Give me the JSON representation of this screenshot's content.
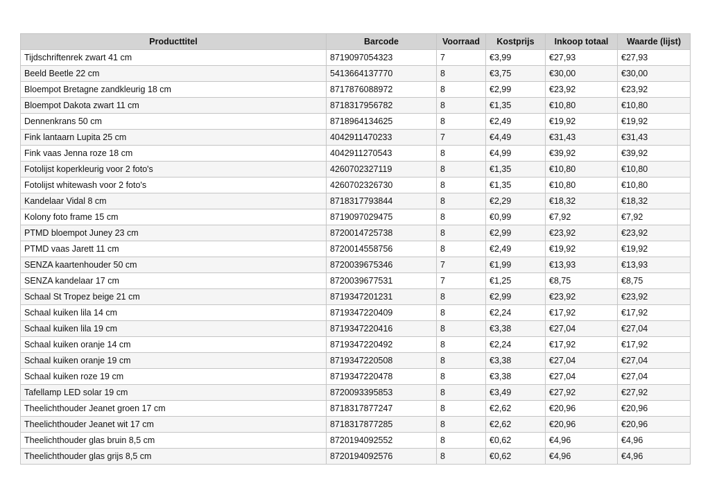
{
  "table": {
    "columns": [
      "Producttitel",
      "Barcode",
      "Voorraad",
      "Kostprijs",
      "Inkoop totaal",
      "Waarde (lijst)"
    ],
    "rows": [
      [
        "Tijdschriftenrek zwart 41 cm",
        "8719097054323",
        "7",
        "€3,99",
        "€27,93",
        "€27,93"
      ],
      [
        "Beeld Beetle 22 cm",
        "5413664137770",
        "8",
        "€3,75",
        "€30,00",
        "€30,00"
      ],
      [
        "Bloempot Bretagne zandkleurig 18 cm",
        "8717876088972",
        "8",
        "€2,99",
        "€23,92",
        "€23,92"
      ],
      [
        "Bloempot Dakota zwart 11 cm",
        "8718317956782",
        "8",
        "€1,35",
        "€10,80",
        "€10,80"
      ],
      [
        "Dennenkrans 50 cm",
        "8718964134625",
        "8",
        "€2,49",
        "€19,92",
        "€19,92"
      ],
      [
        "Fink lantaarn Lupita 25 cm",
        "4042911470233",
        "7",
        "€4,49",
        "€31,43",
        "€31,43"
      ],
      [
        "Fink vaas Jenna roze 18 cm",
        "4042911270543",
        "8",
        "€4,99",
        "€39,92",
        "€39,92"
      ],
      [
        "Fotolijst koperkleurig voor 2 foto's",
        "4260702327119",
        "8",
        "€1,35",
        "€10,80",
        "€10,80"
      ],
      [
        "Fotolijst whitewash voor 2 foto's",
        "4260702326730",
        "8",
        "€1,35",
        "€10,80",
        "€10,80"
      ],
      [
        "Kandelaar Vidal 8 cm",
        "8718317793844",
        "8",
        "€2,29",
        "€18,32",
        "€18,32"
      ],
      [
        "Kolony foto frame 15 cm",
        "8719097029475",
        "8",
        "€0,99",
        "€7,92",
        "€7,92"
      ],
      [
        "PTMD bloempot Juney 23 cm",
        "8720014725738",
        "8",
        "€2,99",
        "€23,92",
        "€23,92"
      ],
      [
        "PTMD vaas Jarett 11 cm",
        "8720014558756",
        "8",
        "€2,49",
        "€19,92",
        "€19,92"
      ],
      [
        "SENZA kaartenhouder 50 cm",
        "8720039675346",
        "7",
        "€1,99",
        "€13,93",
        "€13,93"
      ],
      [
        "SENZA kandelaar 17 cm",
        "8720039677531",
        "7",
        "€1,25",
        "€8,75",
        "€8,75"
      ],
      [
        "Schaal St Tropez beige 21 cm",
        "8719347201231",
        "8",
        "€2,99",
        "€23,92",
        "€23,92"
      ],
      [
        "Schaal kuiken lila 14 cm",
        "8719347220409",
        "8",
        "€2,24",
        "€17,92",
        "€17,92"
      ],
      [
        "Schaal kuiken lila 19 cm",
        "8719347220416",
        "8",
        "€3,38",
        "€27,04",
        "€27,04"
      ],
      [
        "Schaal kuiken oranje 14 cm",
        "8719347220492",
        "8",
        "€2,24",
        "€17,92",
        "€17,92"
      ],
      [
        "Schaal kuiken oranje 19 cm",
        "8719347220508",
        "8",
        "€3,38",
        "€27,04",
        "€27,04"
      ],
      [
        "Schaal kuiken roze 19 cm",
        "8719347220478",
        "8",
        "€3,38",
        "€27,04",
        "€27,04"
      ],
      [
        "Tafellamp LED solar 19 cm",
        "8720093395853",
        "8",
        "€3,49",
        "€27,92",
        "€27,92"
      ],
      [
        "Theelichthouder Jeanet groen 17 cm",
        "8718317877247",
        "8",
        "€2,62",
        "€20,96",
        "€20,96"
      ],
      [
        "Theelichthouder Jeanet wit 17 cm",
        "8718317877285",
        "8",
        "€2,62",
        "€20,96",
        "€20,96"
      ],
      [
        "Theelichthouder glas bruin 8,5 cm",
        "8720194092552",
        "8",
        "€0,62",
        "€4,96",
        "€4,96"
      ],
      [
        "Theelichthouder glas grijs 8,5 cm",
        "8720194092576",
        "8",
        "€0,62",
        "€4,96",
        "€4,96"
      ]
    ]
  }
}
